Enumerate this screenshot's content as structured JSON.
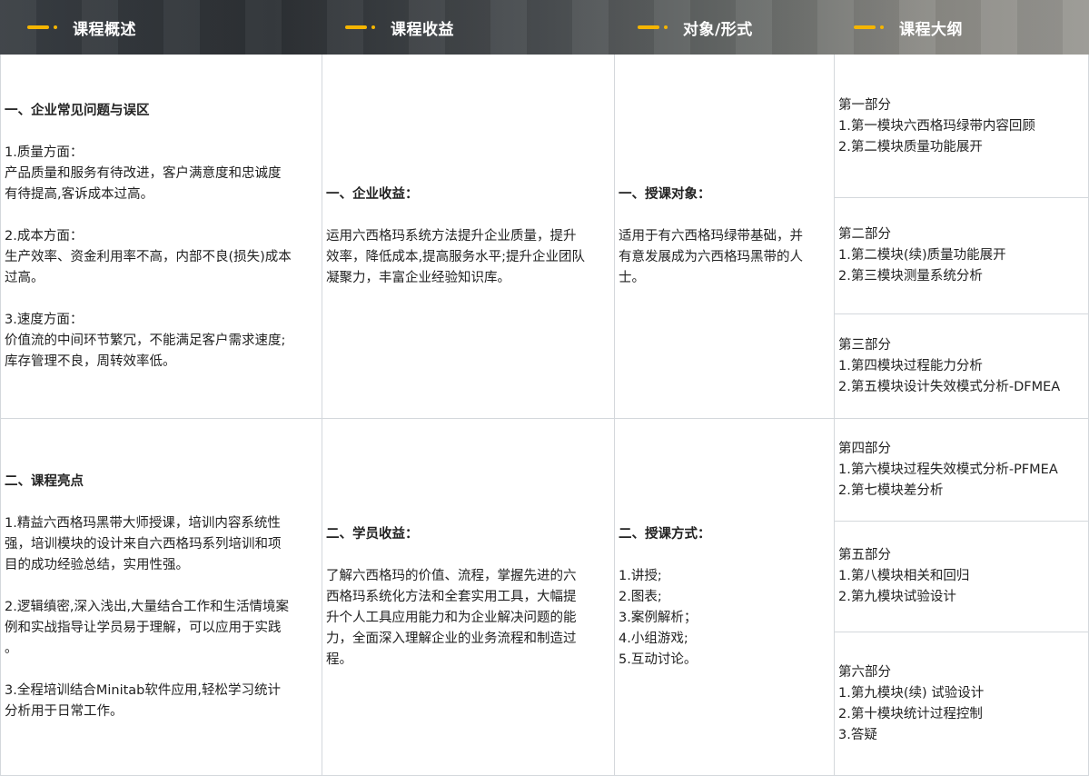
{
  "headers": [
    "课程概述",
    "课程收益",
    "对象/形式",
    "课程大纲"
  ],
  "overview": {
    "section1": {
      "title": "一、企业常见问题与误区",
      "items": [
        {
          "label": "1.质量方面：",
          "lines": [
            "产品质量和服务有待改进，客户满意度和忠诚度",
            "有待提高,客诉成本过高。"
          ]
        },
        {
          "label": "2.成本方面：",
          "lines": [
            "生产效率、资金利用率不高，内部不良(损失)成本",
            "过高。"
          ]
        },
        {
          "label": "3.速度方面：",
          "lines": [
            "价值流的中间环节繁冗，不能满足客户需求速度;",
            "库存管理不良，周转效率低。"
          ]
        }
      ]
    },
    "section2": {
      "title": "二、课程亮点",
      "items": [
        {
          "lines": [
            "1.精益六西格玛黑带大师授课，培训内容系统性",
            "强，培训模块的设计来自六西格玛系列培训和项",
            "目的成功经验总结，实用性强。"
          ]
        },
        {
          "lines": [
            "2.逻辑缜密,深入浅出,大量结合工作和生活情境案",
            "例和实战指导让学员易于理解，可以应用于实践",
            "。"
          ]
        },
        {
          "lines": [
            "3.全程培训结合Minitab软件应用,轻松学习统计",
            "分析用于日常工作。"
          ]
        }
      ]
    }
  },
  "benefits": {
    "enterprise": {
      "title": "一、企业收益：",
      "lines": [
        "运用六西格玛系统方法提升企业质量，提升",
        "效率，降低成本,提高服务水平;提升企业团队",
        "凝聚力，丰富企业经验知识库。"
      ]
    },
    "student": {
      "title": "二、学员收益：",
      "lines": [
        "了解六西格玛的价值、流程，掌握先进的六",
        "西格玛系统化方法和全套实用工具，大幅提",
        "升个人工具应用能力和为企业解决问题的能",
        "力，全面深入理解企业的业务流程和制造过",
        "程。"
      ]
    }
  },
  "target": {
    "audience": {
      "title": "一、授课对象：",
      "lines": [
        "适用于有六西格玛绿带基础，并",
        "有意发展成为六西格玛黑带的人",
        "士。"
      ]
    },
    "format": {
      "title": "二、授课方式：",
      "lines": [
        "1.讲授;",
        "2.图表;",
        "3.案例解析；",
        "4.小组游戏;",
        "5.互动讨论。"
      ]
    }
  },
  "outline": [
    {
      "part": "第一部分",
      "lines": [
        "1.第一模块六西格玛绿带内容回顾",
        "2.第二模块质量功能展开"
      ]
    },
    {
      "part": "第二部分",
      "lines": [
        "1.第二模块(续)质量功能展开",
        "2.第三模块测量系统分析"
      ]
    },
    {
      "part": "第三部分",
      "lines": [
        "1.第四模块过程能力分析",
        "2.第五模块设计失效模式分析-DFMEA"
      ]
    },
    {
      "part": "第四部分",
      "lines": [
        "1.第六模块过程失效模式分析-PFMEA",
        "2.第七模块差分析"
      ]
    },
    {
      "part": "第五部分",
      "lines": [
        "1.第八模块相关和回归",
        "2.第九模块试验设计"
      ]
    },
    {
      "part": "第六部分",
      "lines": [
        "1.第九模块(续) 试验设计",
        "2.第十模块统计过程控制",
        "3.答疑"
      ]
    }
  ],
  "colors": {
    "accent": "#f5b500",
    "border": "#d4d8dc",
    "header_text": "#ffffff"
  }
}
